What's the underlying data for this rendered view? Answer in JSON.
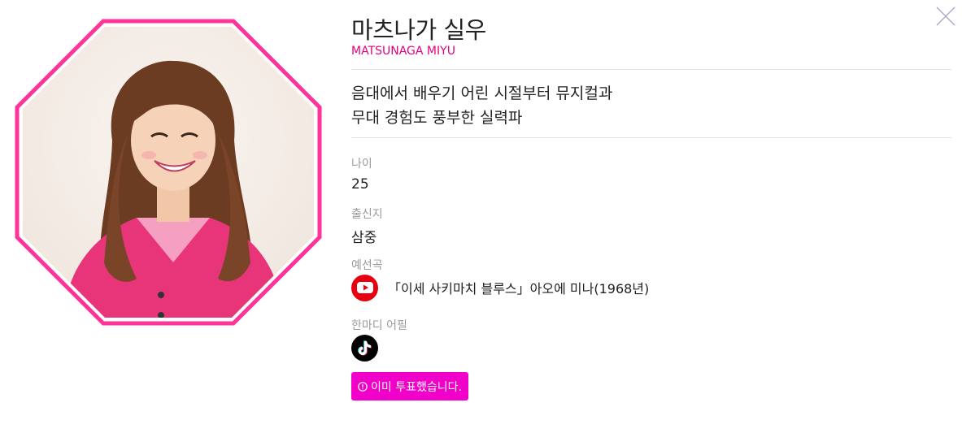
{
  "profile": {
    "name": "마츠나가 실우",
    "romaji": "MATSUNAGA MIYU",
    "catchphrase": [
      "음대에서 배우기 어린 시절부터 뮤지컬과",
      "무대 경험도 풍부한 실력파"
    ],
    "age_label": "나이",
    "age_value": "25",
    "hometown_label": "출신지",
    "hometown_value": "삼중",
    "song_label": "예선곡",
    "song_value": "「이세 사키마치 블루스」아오에 미나(1968년)",
    "appeal_label": "한마디 어필"
  },
  "vote_button": {
    "label": "이미 투표했습니다."
  },
  "icons": {
    "close": "close-icon",
    "youtube": "youtube-icon",
    "tiktok": "tiktok-icon",
    "info": "info-icon"
  },
  "colors": {
    "accent_pink": "#e4007f",
    "frame_pink": "#ff3399",
    "button_magenta": "#f000c8",
    "youtube_red": "#e60012"
  }
}
